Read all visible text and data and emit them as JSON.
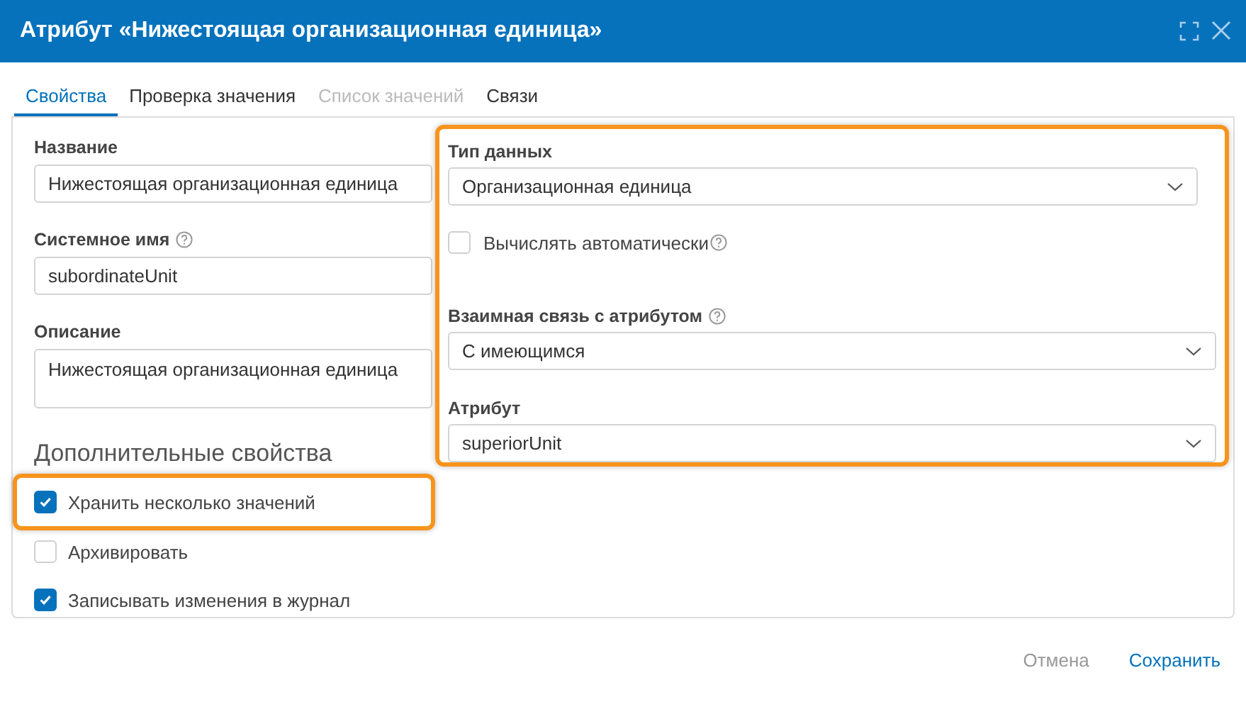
{
  "window": {
    "title": "Атрибут «Нижестоящая организационная единица»"
  },
  "tabs": [
    {
      "label": "Свойства",
      "selected": true,
      "disabled": false
    },
    {
      "label": "Проверка значения",
      "selected": false,
      "disabled": false
    },
    {
      "label": "Список значений",
      "selected": false,
      "disabled": true
    },
    {
      "label": "Связи",
      "selected": false,
      "disabled": false
    }
  ],
  "fields": [
    {
      "label": "Название",
      "help": false,
      "value": "Нижестоящая организационная единица",
      "kind": "text"
    },
    {
      "label": "Системное имя",
      "help": true,
      "value": "subordinateUnit",
      "kind": "text"
    },
    {
      "label": "Описание",
      "help": false,
      "value": "Нижестоящая организационная единица",
      "kind": "textarea"
    }
  ],
  "extra_section": {
    "title": "Дополнительные свойства",
    "options": [
      {
        "label": "Хранить несколько значений",
        "checked": true,
        "highlighted": true
      },
      {
        "label": "Архивировать",
        "checked": false,
        "highlighted": false
      },
      {
        "label": "Записывать изменения в журнал",
        "checked": true,
        "highlighted": false
      }
    ]
  },
  "type_panel": {
    "highlighted": true,
    "data_type": {
      "label": "Тип данных",
      "value": "Организационная единица"
    },
    "auto_compute": {
      "label": "Вычислять автоматически",
      "checked": false,
      "help": true
    },
    "mutual_link": {
      "label": "Взаимная связь с атрибутом",
      "help": true,
      "value": "С имеющимся"
    },
    "attribute": {
      "label": "Атрибут",
      "value": "superiorUnit"
    }
  },
  "footer_buttons": [
    {
      "label": "Отмена",
      "kind": "secondary"
    },
    {
      "label": "Сохранить",
      "kind": "primary"
    }
  ]
}
